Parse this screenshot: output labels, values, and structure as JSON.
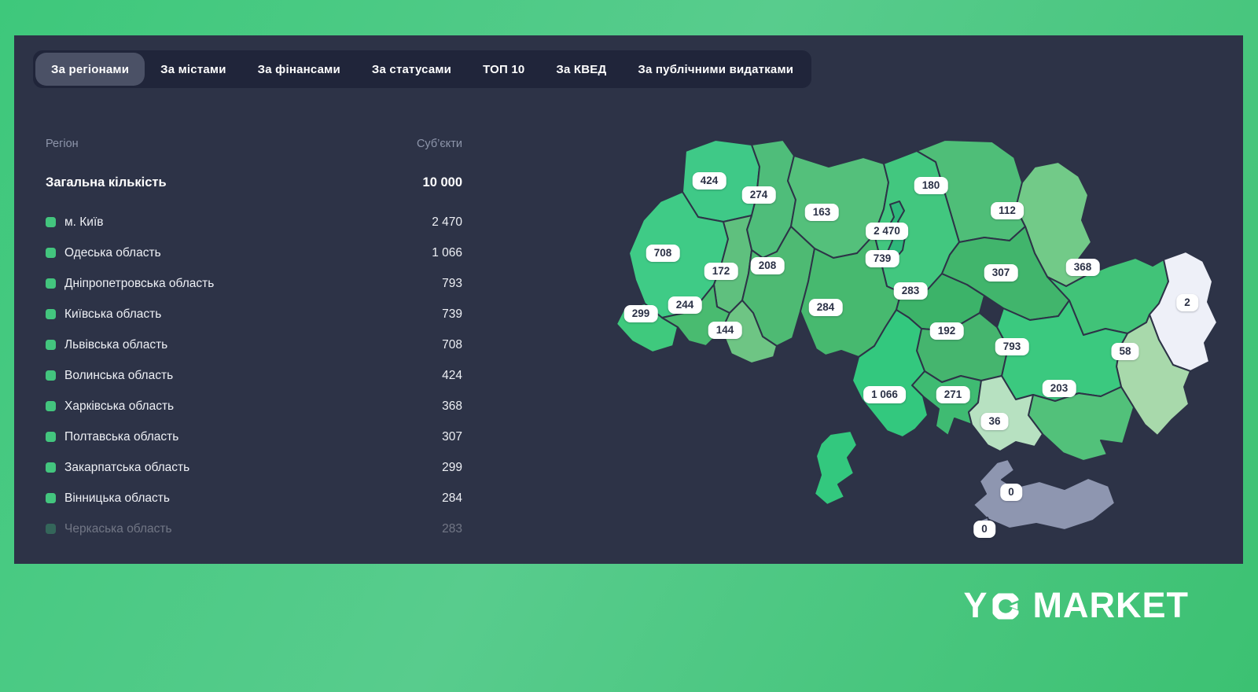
{
  "tabs": {
    "active_index": 0,
    "items": [
      "За регіонами",
      "За містами",
      "За фінансами",
      "За статусами",
      "ТОП 10",
      "За КВЕД",
      "За публічними видатками"
    ]
  },
  "table": {
    "header": {
      "region": "Регіон",
      "subjects": "Суб’єкти"
    },
    "total": {
      "label": "Загальна кількість",
      "value": "10 000"
    },
    "rows": [
      {
        "label": "м. Київ",
        "value": "2 470"
      },
      {
        "label": "Одеська область",
        "value": "1 066"
      },
      {
        "label": "Дніпропетровська область",
        "value": "793"
      },
      {
        "label": "Київська область",
        "value": "739"
      },
      {
        "label": "Львівська область",
        "value": "708"
      },
      {
        "label": "Волинська область",
        "value": "424"
      },
      {
        "label": "Харківська область",
        "value": "368"
      },
      {
        "label": "Полтавська область",
        "value": "307"
      },
      {
        "label": "Закарпатська область",
        "value": "299"
      },
      {
        "label": "Вінницька область",
        "value": "284"
      },
      {
        "label": "Черкаська область",
        "value": "283"
      }
    ]
  },
  "map": {
    "regions": [
      {
        "id": "volyn",
        "value": "424",
        "color": "#3fc987"
      },
      {
        "id": "rivne",
        "value": "274",
        "color": "#4fbd7a"
      },
      {
        "id": "zhytomyr",
        "value": "163",
        "color": "#54c07b"
      },
      {
        "id": "chernihiv",
        "value": "180",
        "color": "#4fbe78"
      },
      {
        "id": "sumy",
        "value": "112",
        "color": "#72ca88"
      },
      {
        "id": "kyiv-oblast",
        "value": "739",
        "color": "#42c77f"
      },
      {
        "id": "kyiv-city",
        "value": "2 470",
        "color": "#2eb87b"
      },
      {
        "id": "lviv",
        "value": "708",
        "color": "#3fcb86"
      },
      {
        "id": "ternopil",
        "value": "172",
        "color": "#5fc07e"
      },
      {
        "id": "khmelnytskyi",
        "value": "208",
        "color": "#4eba73"
      },
      {
        "id": "vinnytsia",
        "value": "284",
        "color": "#47b96f"
      },
      {
        "id": "cherkasy",
        "value": "283",
        "color": "#3cb369"
      },
      {
        "id": "poltava",
        "value": "307",
        "color": "#41b56c"
      },
      {
        "id": "kharkiv",
        "value": "368",
        "color": "#41c378"
      },
      {
        "id": "luhansk",
        "value": "2",
        "color": "#eef0f8"
      },
      {
        "id": "donetsk",
        "value": "58",
        "color": "#a8d9ab"
      },
      {
        "id": "dnipro",
        "value": "793",
        "color": "#3bc97f"
      },
      {
        "id": "zaporizhzhia",
        "value": "203",
        "color": "#52c17a"
      },
      {
        "id": "kirovohrad",
        "value": "192",
        "color": "#45b56e"
      },
      {
        "id": "mykolaiv",
        "value": "271",
        "color": "#3fbb72"
      },
      {
        "id": "odesa",
        "value": "1 066",
        "color": "#33c87e"
      },
      {
        "id": "odesa-budjak",
        "value": "",
        "color": "#33c87e"
      },
      {
        "id": "kherson",
        "value": "36",
        "color": "#b7e1c1"
      },
      {
        "id": "crimea",
        "value": "0",
        "color": "#8e96b0"
      },
      {
        "id": "sevastopol",
        "value": "0",
        "color": "#8e96b0"
      },
      {
        "id": "zakarpattia",
        "value": "299",
        "color": "#3fc97d"
      },
      {
        "id": "ivano-frankivsk",
        "value": "244",
        "color": "#49bb70"
      },
      {
        "id": "chernivtsi",
        "value": "144",
        "color": "#6ec584"
      }
    ]
  },
  "brand": {
    "full": "YC MARKET",
    "letter_y": "Y",
    "word": "MARKET"
  },
  "colors": {
    "panel": "#2d3347",
    "tabbar": "#20253a",
    "active_tab": "#4b5166",
    "accent_green": "#43c57e",
    "background_green": "#4cca83",
    "zero_region_gray": "#8e96b0",
    "chip_background": "#ffffff"
  }
}
